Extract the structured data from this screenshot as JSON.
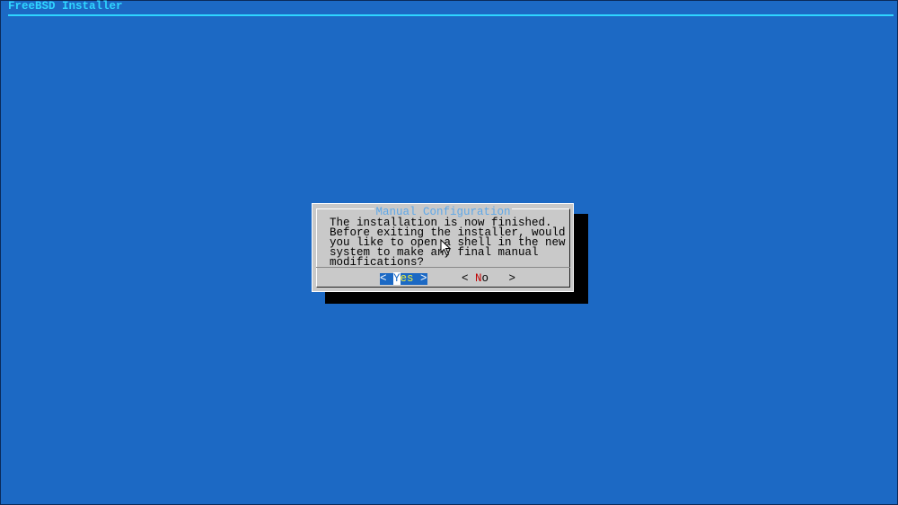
{
  "app_title": "FreeBSD Installer",
  "dialog": {
    "title": "Manual Configuration",
    "message": "The installation is now finished.\nBefore exiting the installer, would\nyou like to open a shell in the new\nsystem to make any final manual\nmodifications?",
    "buttons": {
      "yes": {
        "left": "< ",
        "hot": "Y",
        "rest": "es",
        " right": " >",
        "right": " >"
      },
      "no": {
        "left": "< ",
        "hot": "N",
        "rest": "o ",
        "right": "  >"
      }
    }
  }
}
